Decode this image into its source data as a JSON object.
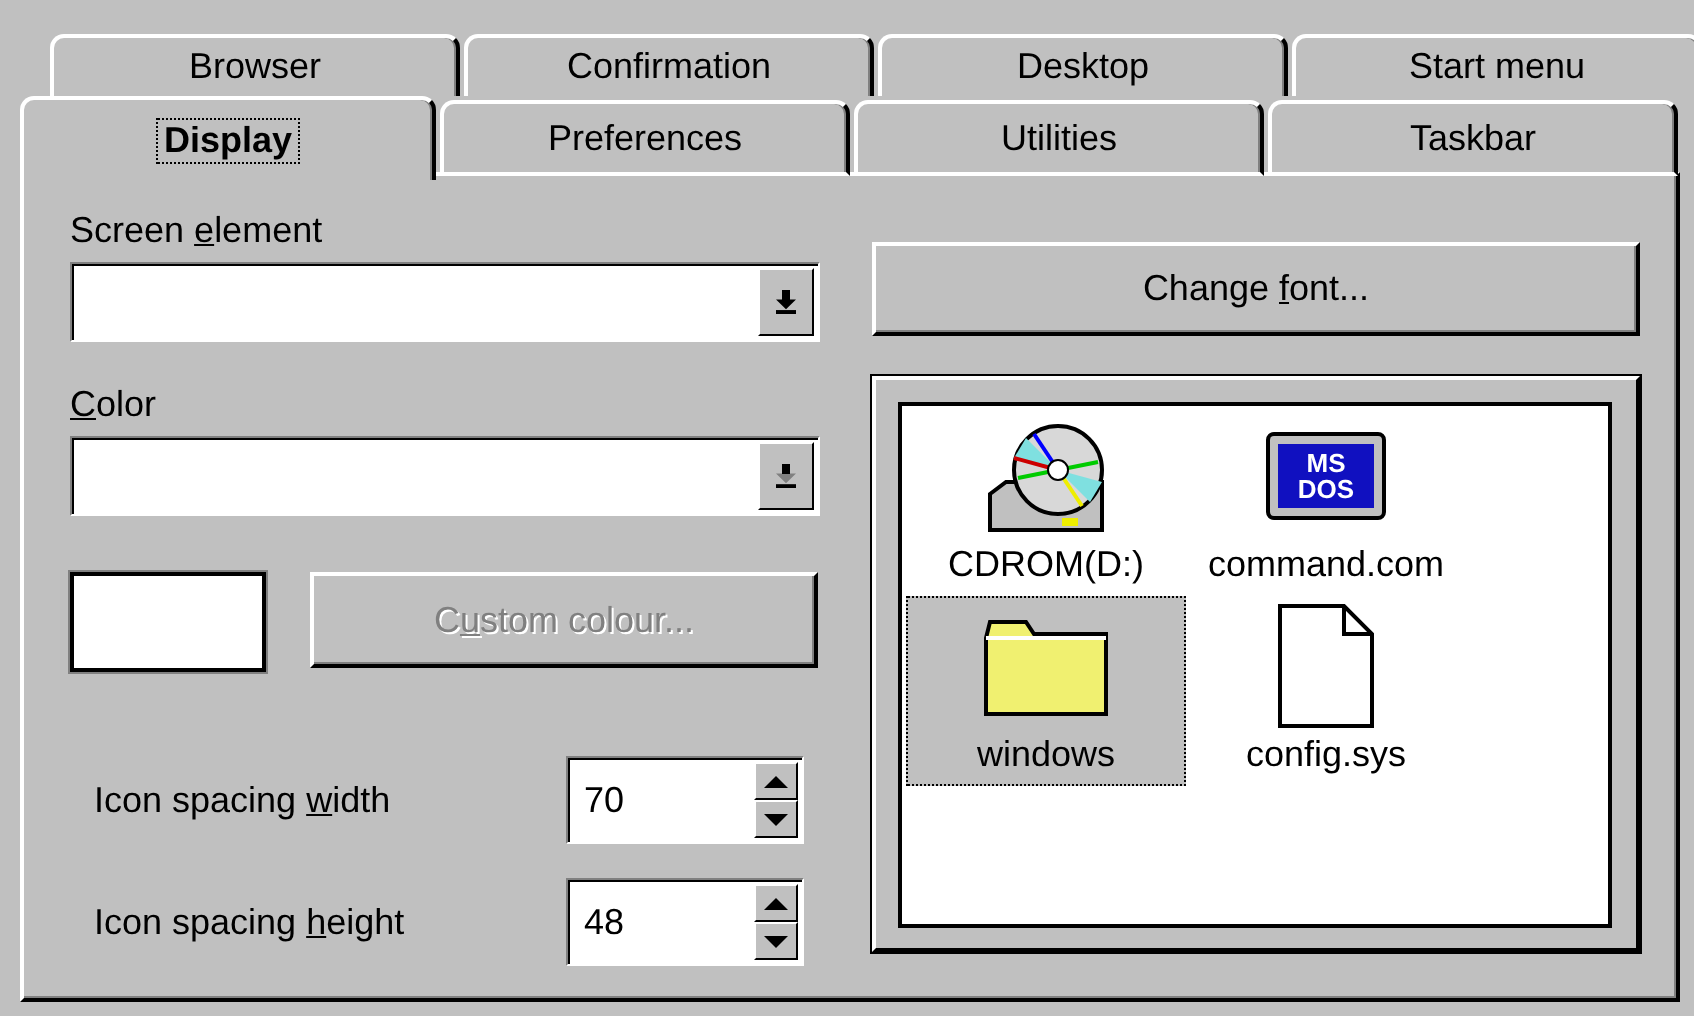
{
  "tabs_back": [
    {
      "label": "Browser",
      "selected": false
    },
    {
      "label": "Confirmation",
      "selected": false
    },
    {
      "label": "Desktop",
      "selected": false
    },
    {
      "label": "Start menu",
      "selected": false
    }
  ],
  "tabs_front": [
    {
      "label": "Display",
      "selected": true
    },
    {
      "label": "Preferences",
      "selected": false
    },
    {
      "label": "Utilities",
      "selected": false
    },
    {
      "label": "Taskbar",
      "selected": false
    }
  ],
  "display": {
    "screen_element": {
      "label": {
        "before": "Screen ",
        "key": "e",
        "after": "lement"
      },
      "disabled": false
    },
    "color": {
      "label": {
        "key": "C",
        "after": "olor"
      },
      "disabled": true
    },
    "custom_colour_button": {
      "label": {
        "before": "C",
        "key": "u",
        "after": "stom colour..."
      },
      "disabled": true
    },
    "change_font_button": {
      "label": {
        "before": "Change ",
        "key": "f",
        "after": "ont..."
      },
      "disabled": false
    },
    "spinners": [
      {
        "label": {
          "before": "Icon spacing ",
          "key": "w",
          "after": "idth"
        },
        "value": "70"
      },
      {
        "label": {
          "before": "Icon spacing ",
          "key": "h",
          "after": "eight"
        },
        "value": "48"
      }
    ],
    "dos_icon_text": [
      "MS",
      "DOS"
    ],
    "preview_icons": [
      {
        "kind": "cdrom",
        "label": "CDROM(D:)",
        "selected": false
      },
      {
        "kind": "msdos",
        "label": "command.com",
        "selected": false
      },
      {
        "kind": "folder",
        "label": "windows",
        "selected": true
      },
      {
        "kind": "file",
        "label": "config.sys",
        "selected": false
      }
    ]
  }
}
